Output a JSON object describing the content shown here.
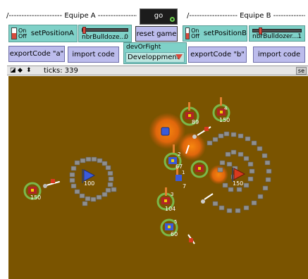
{
  "header": {
    "team_a_label": "/--------------------- Equipe A ---------------------\\",
    "team_b_label": "/------------------- Equipe B -------------------\\"
  },
  "controls": {
    "go_button": "go",
    "switch_states": {
      "on": "On",
      "off": "Off"
    },
    "set_position_a": "setPositionA",
    "set_position_b": "setPositionB",
    "bulldozer_a": {
      "label": "nbrBulldoze...",
      "value": "0",
      "fraction": 0
    },
    "bulldozer_b": {
      "label": "nbrBulldozer...",
      "value": "1",
      "fraction": 0.1
    },
    "reset_game": "reset game",
    "export_a": "exportCode \"a\"",
    "import_a": "import code",
    "mode_chooser": {
      "label": "devOrFight",
      "value": "Developpment"
    },
    "export_b": "exportCode \"b\"",
    "import_b": "import code"
  },
  "world_bar": {
    "ticks_label": "ticks: 339",
    "icons": [
      "speed-icon",
      "arrows-icon",
      "updown-icon"
    ],
    "settings_label": "se"
  },
  "world": {
    "background": "#7a5400",
    "team_a_color": "#d93a1e",
    "team_b_color": "#3b5bd9",
    "labels": {
      "base_a": "100",
      "base_b": "150",
      "u1": "150",
      "u2": "89",
      "u3": "150",
      "u4": "67",
      "u5": "7",
      "u6": "104",
      "u7": "60",
      "n2": "2",
      "n3": "3",
      "n4": "4",
      "n5": "5",
      "n1": "1"
    }
  }
}
